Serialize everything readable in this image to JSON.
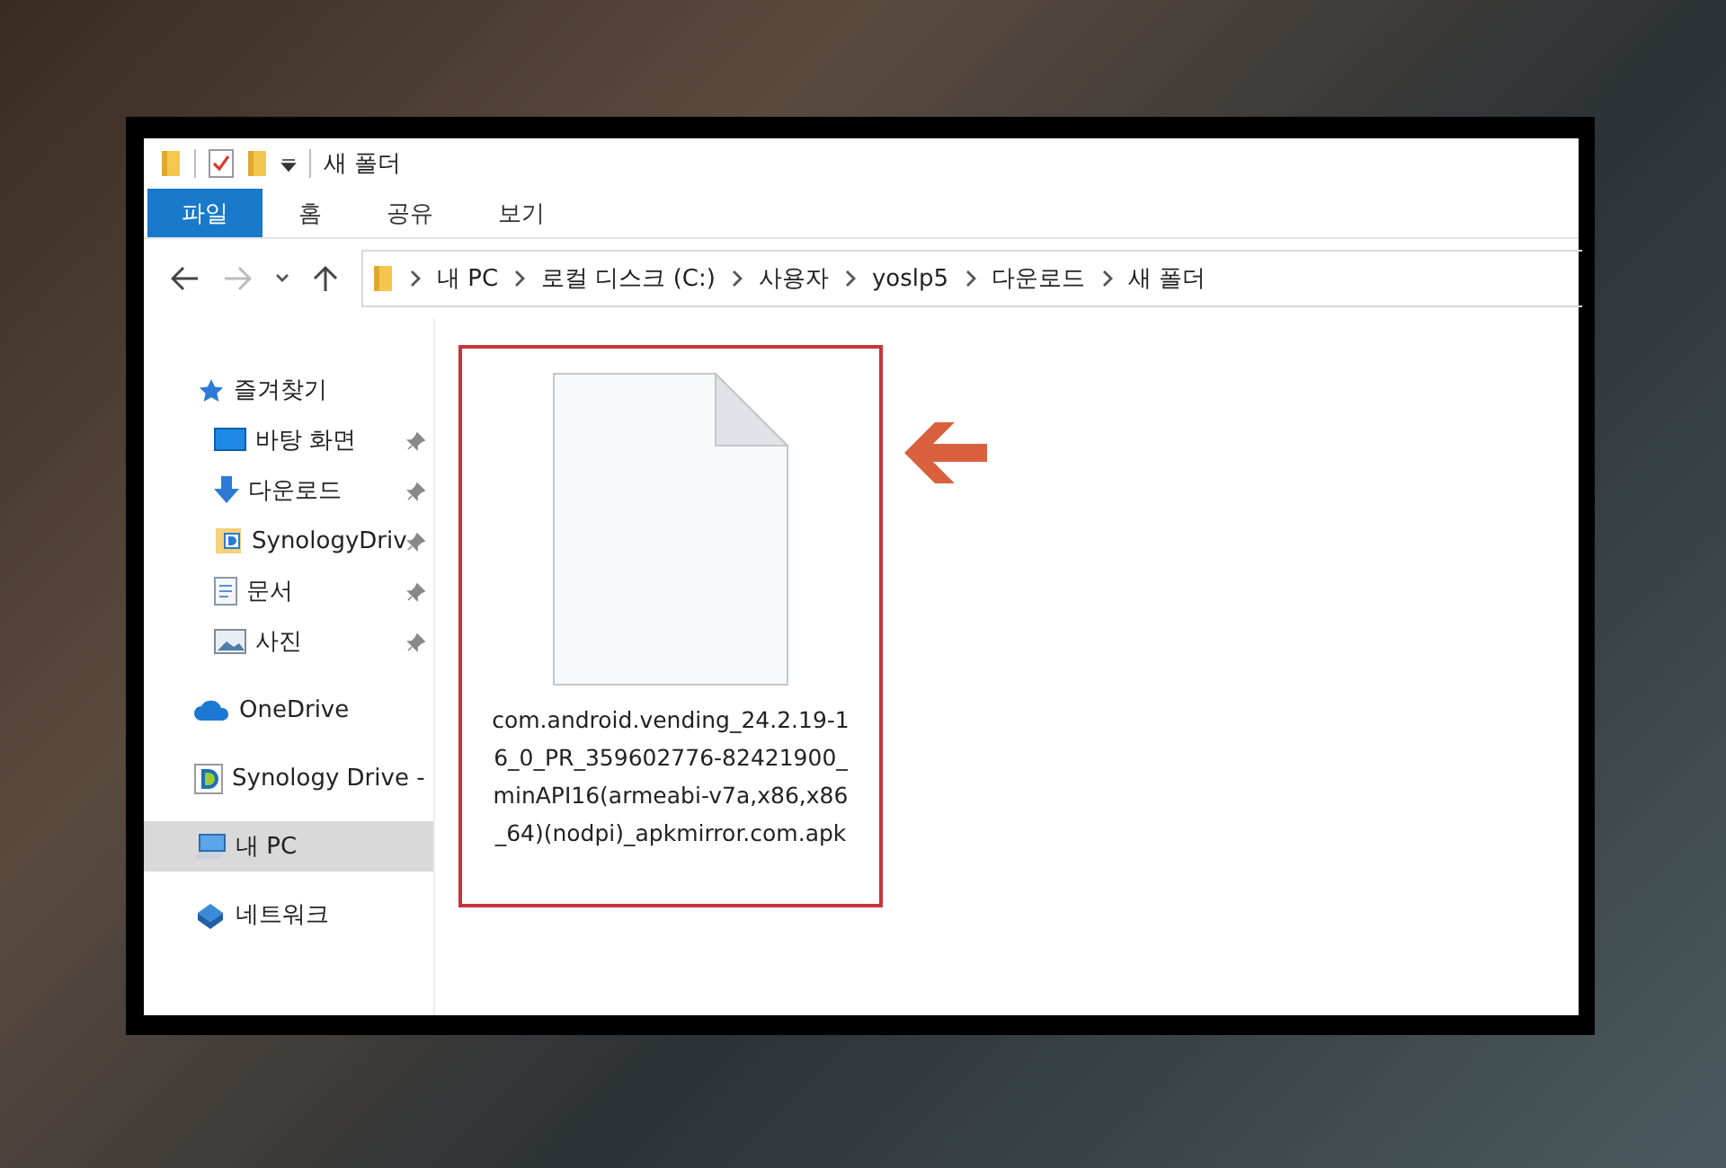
{
  "window": {
    "title": "새 폴더"
  },
  "ribbon_tabs": [
    {
      "label": "파일",
      "selected": true
    },
    {
      "label": "홈",
      "selected": false
    },
    {
      "label": "공유",
      "selected": false
    },
    {
      "label": "보기",
      "selected": false
    }
  ],
  "address_bar": {
    "path": [
      "내 PC",
      "로컬 디스크 (C:)",
      "사용자",
      "yoslp5",
      "다운로드",
      "새 폴더"
    ]
  },
  "navigation": [
    {
      "label": "즐겨찾기",
      "kind": "favorites",
      "selected": false,
      "children": [
        {
          "label": "바탕 화면",
          "kind": "desktop",
          "pinned": true,
          "selected": false
        },
        {
          "label": "다운로드",
          "kind": "downloads",
          "pinned": true,
          "selected": false
        },
        {
          "label": "SynologyDriv",
          "kind": "synology-folder",
          "pinned": true,
          "selected": false
        },
        {
          "label": "문서",
          "kind": "documents",
          "pinned": true,
          "selected": false
        },
        {
          "label": "사진",
          "kind": "pictures",
          "pinned": true,
          "selected": false
        }
      ]
    },
    {
      "label": "OneDrive",
      "kind": "onedrive",
      "selected": false
    },
    {
      "label": "Synology Drive -",
      "kind": "synology",
      "selected": false
    },
    {
      "label": "내 PC",
      "kind": "pc",
      "selected": true
    },
    {
      "label": "네트워크",
      "kind": "network",
      "selected": false
    }
  ],
  "files": [
    {
      "name": "com.android.vending_24.2.19-16_0_PR_359602776-82421900_minAPI16(armeabi-v7a,x86,x86_64)(nodpi)_apkmirror.com.apk",
      "highlighted": true
    }
  ]
}
